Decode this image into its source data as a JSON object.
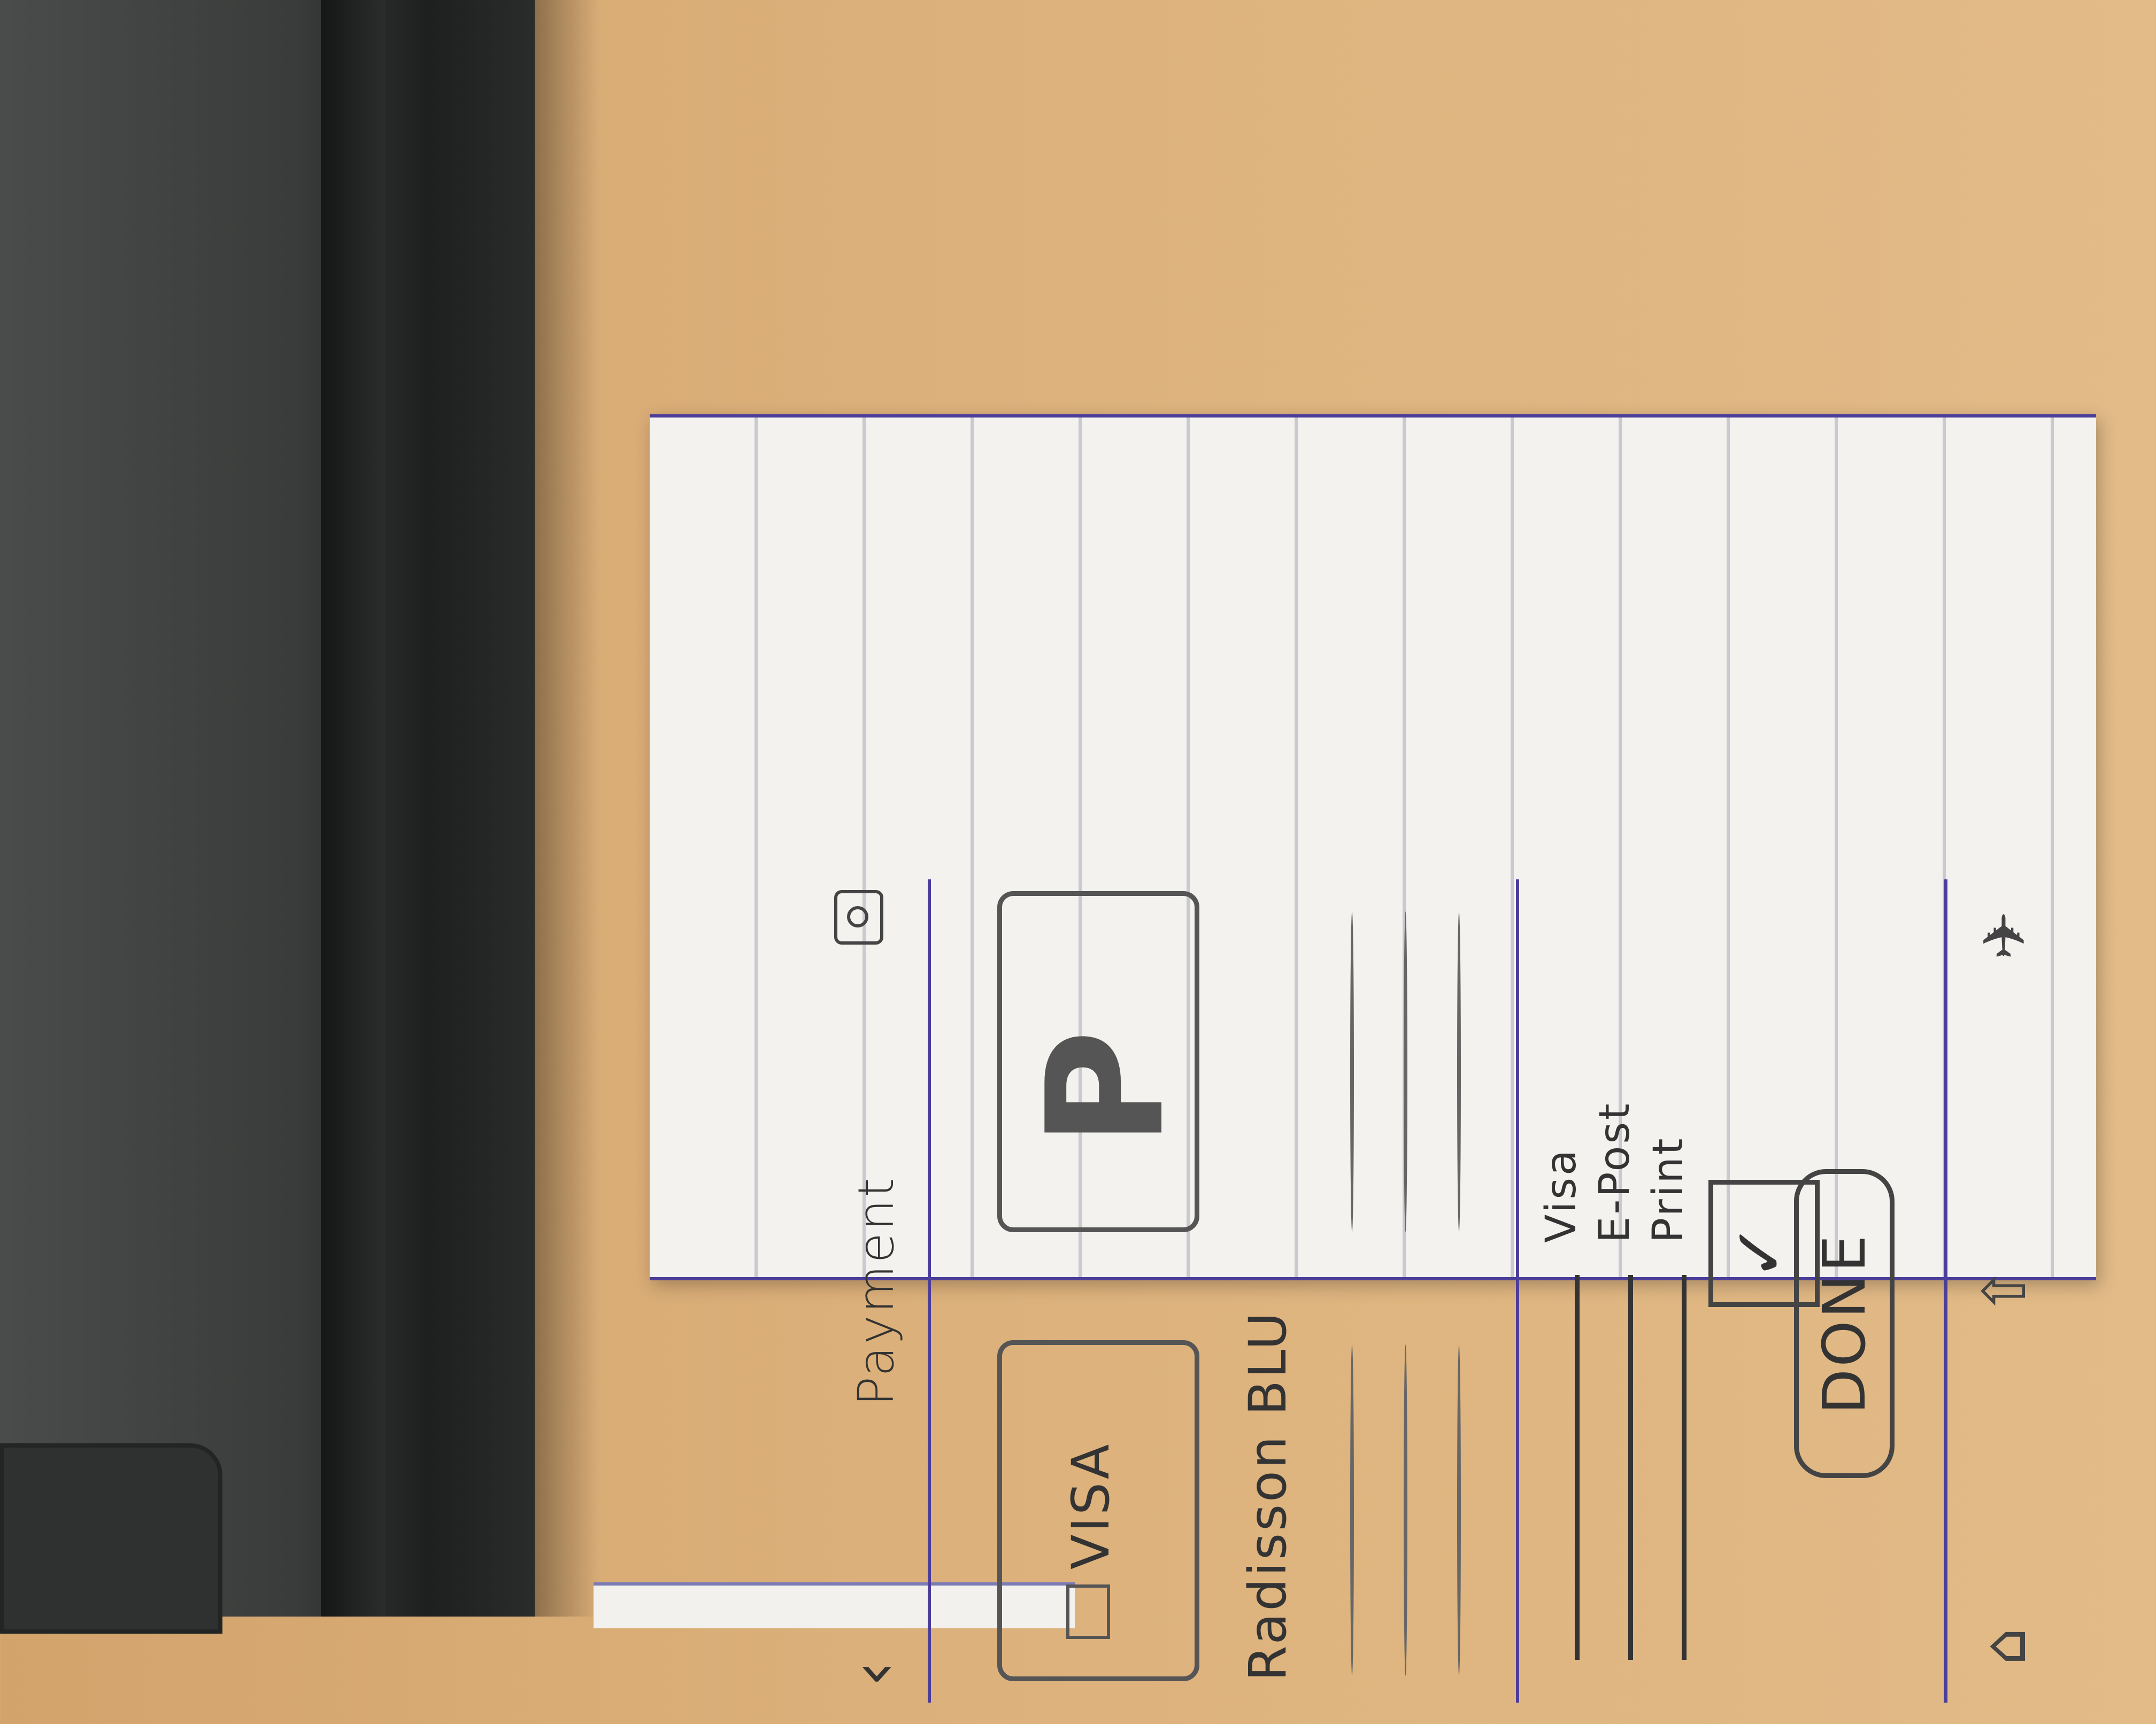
{
  "screen": {
    "title": "Payment",
    "back_icon": "chevron-left-icon",
    "settings_icon": "settings-icon"
  },
  "payment_methods": [
    {
      "name": "visa-card",
      "label": "VISA"
    },
    {
      "name": "paypal-card",
      "label": "P"
    }
  ],
  "hotel": {
    "name": "Radisson BLU"
  },
  "options": [
    {
      "label": "Visa"
    },
    {
      "label": "E-Post"
    },
    {
      "label": "Print"
    }
  ],
  "checkbox": {
    "mark": "✓",
    "checked": true
  },
  "done_button": {
    "label": "DONE"
  },
  "tabbar": [
    {
      "icon": "home-icon"
    },
    {
      "icon": "up-arrow-icon"
    },
    {
      "icon": "plane-icon"
    }
  ],
  "colors": {
    "ink": "#333333",
    "frame": "#4b3d9a",
    "paper": "#f4f2ee"
  }
}
